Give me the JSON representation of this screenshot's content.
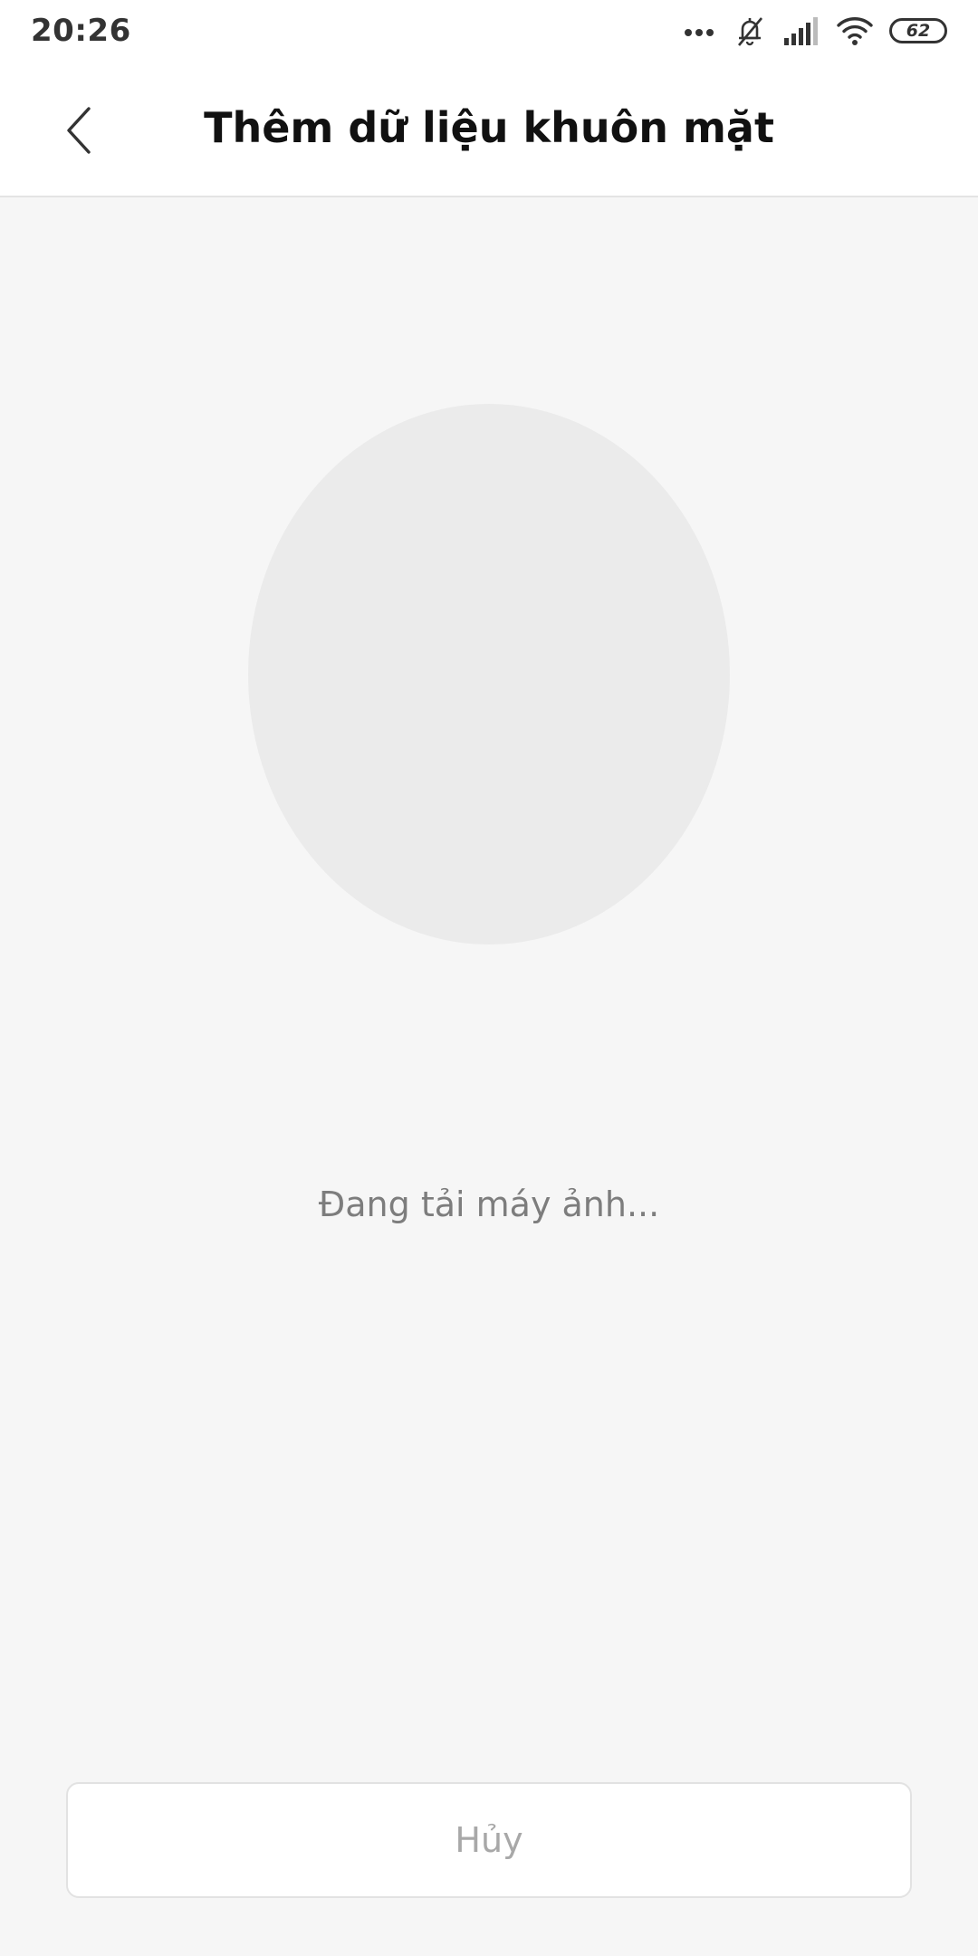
{
  "status_bar": {
    "time": "20:26",
    "icons": [
      "more-dots-icon",
      "bell-off-icon",
      "signal-icon",
      "wifi-icon",
      "battery-icon"
    ],
    "battery_level": "62"
  },
  "header": {
    "back_icon": "chevron-left-icon",
    "title": "Thêm dữ liệu khuôn mặt"
  },
  "main": {
    "loading_text": "Đang tải máy ảnh..."
  },
  "footer": {
    "cancel_label": "Hủy"
  },
  "colors": {
    "background": "#f6f6f6",
    "header_background": "#ffffff",
    "face_placeholder": "#ebebeb",
    "title_text": "#111111",
    "muted_text": "#7d7d7d",
    "button_text": "#a8a8a8"
  }
}
